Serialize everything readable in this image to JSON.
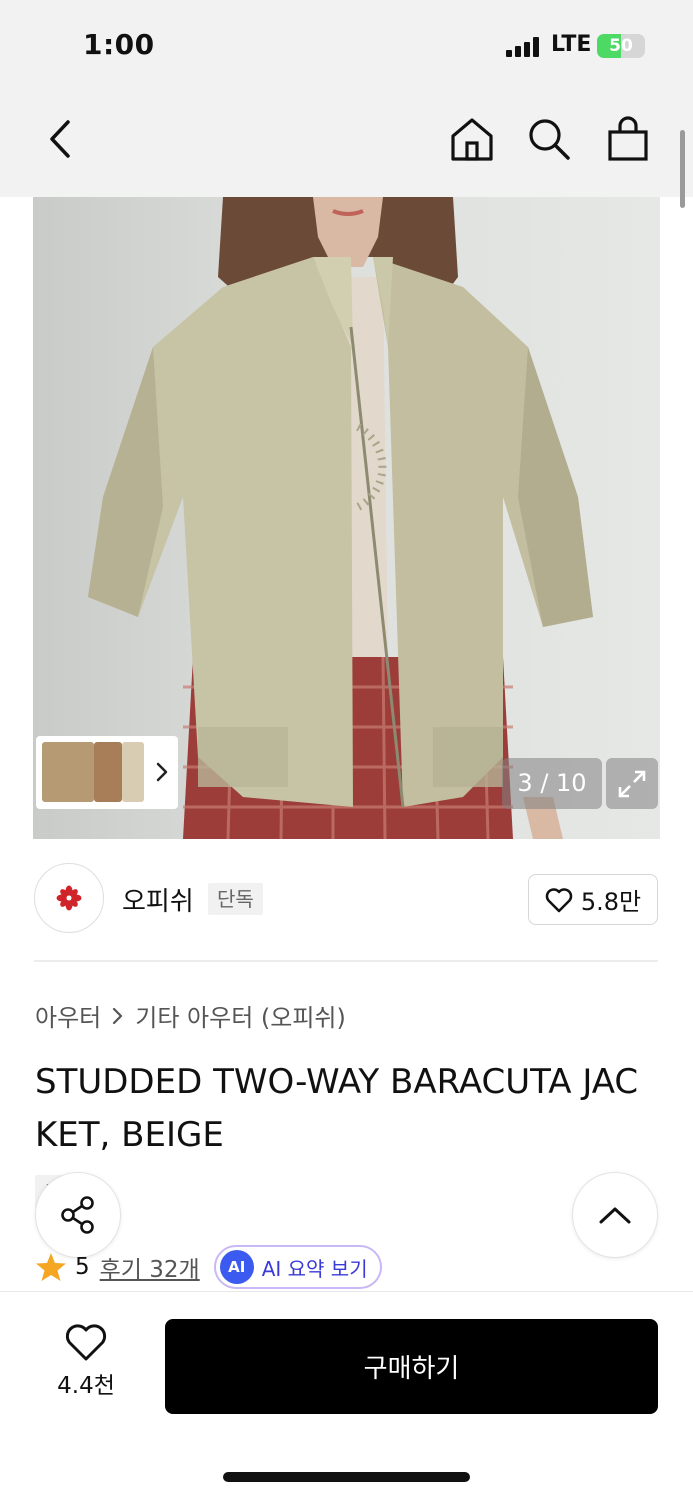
{
  "status_bar": {
    "time": "1:00",
    "network": "LTE",
    "battery": "50",
    "battery_level": 0.5
  },
  "nav": {
    "back_icon": "chevron-left-icon",
    "home_icon": "home-icon",
    "search_icon": "search-icon",
    "cart_icon": "shopping-bag-icon"
  },
  "gallery": {
    "counter": "3 / 10",
    "expand_icon": "expand-icon"
  },
  "brand": {
    "name": "오피쉬",
    "badge": "단독",
    "likes": "5.8만",
    "logo_color": "#d0242b"
  },
  "breadcrumb": {
    "level1": "아우터",
    "level2": "기타 아우터 (오피쉬)"
  },
  "product": {
    "title": "STUDDED TWO-WAY BARACUTA JACKET, BEIGE",
    "exclusive_tag": "단독"
  },
  "rating": {
    "score": "5",
    "reviews": "후기 32개",
    "ai_badge": "AI",
    "ai_summary": "AI 요약 보기",
    "star_color": "#f5a623"
  },
  "bottom_bar": {
    "wish_count": "4.4천",
    "buy_label": "구매하기"
  }
}
